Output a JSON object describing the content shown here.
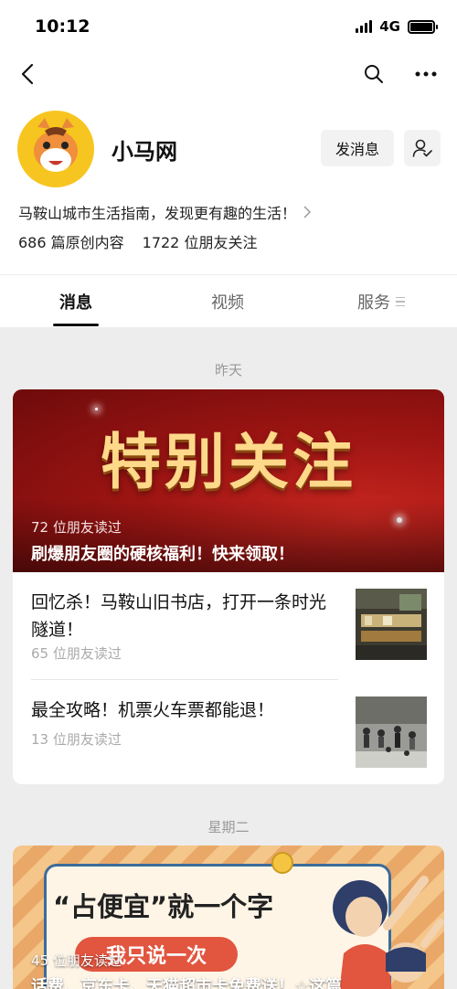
{
  "status_bar": {
    "time": "10:12",
    "network": "4G"
  },
  "header": {
    "back_icon": "chevron-left-icon",
    "search_icon": "search-icon",
    "more_icon": "more-dots-icon"
  },
  "profile": {
    "name": "小马网",
    "send_message_label": "发消息",
    "follow_icon": "person-check-icon",
    "bio": "马鞍山城市生活指南，发现更有趣的生活！",
    "original_count_text": "686 篇原创内容",
    "followers_text": "1722 位朋友关注"
  },
  "tabs": [
    {
      "label": "消息",
      "active": true
    },
    {
      "label": "视频",
      "active": false
    },
    {
      "label": "服务",
      "active": false
    }
  ],
  "feed": [
    {
      "date": "昨天",
      "banner": {
        "image_text": "特别关注",
        "reads": "72 位朋友读过",
        "title": "刷爆朋友圈的硬核福利！快来领取！"
      },
      "articles": [
        {
          "title": "回忆杀！马鞍山旧书店，打开一条时光隧道！",
          "reads": "65 位朋友读过"
        },
        {
          "title": "最全攻略！机票火车票都能退！",
          "reads": "13 位朋友读过"
        }
      ]
    },
    {
      "date": "星期二",
      "banner": {
        "image_title": "“占便宜”就一个字",
        "image_pill": "我只说一次",
        "reads": "45 位朋友读过",
        "title": "话费、京东卡、天猫超市卡免费送！☆这篇"
      }
    }
  ],
  "colors": {
    "accent_red": "#9e1513",
    "background": "#ededed"
  }
}
